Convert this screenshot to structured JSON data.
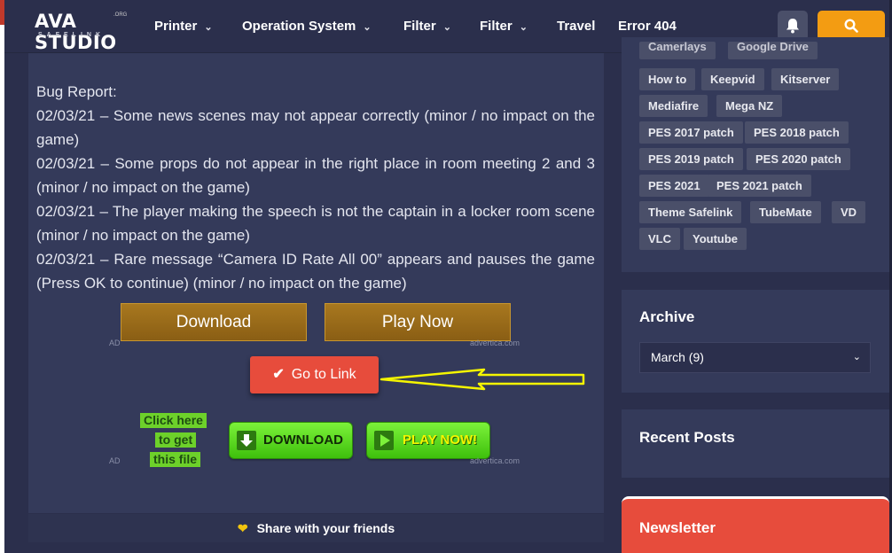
{
  "header": {
    "logo_main": "AVA STUDIO",
    "logo_dot": ".ORG",
    "logo_sub": "SAFELINK",
    "nav": [
      {
        "label": "Printer",
        "has_dropdown": true
      },
      {
        "label": "Operation System",
        "has_dropdown": true
      },
      {
        "label": "Filter",
        "has_dropdown": true
      },
      {
        "label": "Filter",
        "has_dropdown": true
      },
      {
        "label": "Travel",
        "has_dropdown": false
      },
      {
        "label": "Error 404",
        "has_dropdown": false
      }
    ],
    "icons": {
      "bell": "bell-icon",
      "search": "search-icon"
    },
    "accent_color": "#f39c12"
  },
  "article": {
    "bug_title": "Bug Report:",
    "bug_lines": [
      "02/03/21 – Some news scenes may not appear correctly (minor / no impact on the game)",
      "02/03/21 – Some props do not appear in the right place in room meeting 2 and 3 (minor / no impact on the game)",
      "02/03/21 – The player making the speech is not the captain in a locker room scene (minor / no impact on the game)",
      "02/03/21 – Rare message “Camera ID Rate All 00” appears and pauses the game (Press OK to continue) (minor / no impact on the game)"
    ],
    "download_label": "Download",
    "play_now_label": "Play Now",
    "ad_label": "AD",
    "advertica_label": "advertica.com",
    "go_link_label": "Go to Link",
    "click_here_lines": [
      "Click here",
      "to get",
      "this file"
    ],
    "green_download_label": "DOWNLOAD",
    "green_play_label": "PLAY NOW!",
    "share_label": "Share with your friends",
    "go_link_color": "#e74c3c"
  },
  "sidebar": {
    "tags_partial_top": [
      "Camerlays",
      "Google Drive"
    ],
    "tags": [
      "How to",
      "Keepvid",
      "Kitserver",
      "Mediafire",
      "Mega NZ",
      "PES 2017 patch",
      "PES 2018 patch",
      "PES 2019 patch",
      "PES 2020 patch",
      "PES 2021",
      "PES 2021 patch",
      "Theme Safelink",
      "TubeMate",
      "VD",
      "VLC",
      "Youtube"
    ],
    "archive_title": "Archive",
    "archive_selected": "March (9)",
    "recent_title": "Recent Posts",
    "newsletter_title": "Newsletter",
    "newsletter_color": "#e74c3c"
  }
}
